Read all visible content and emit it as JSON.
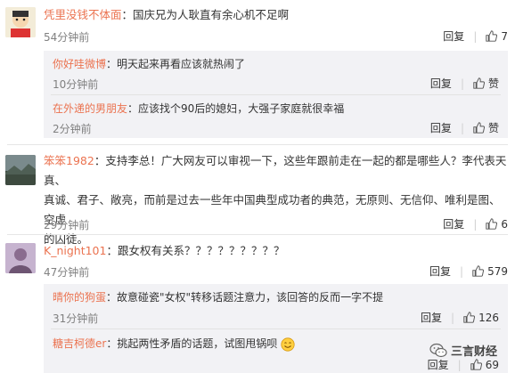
{
  "comments": [
    {
      "user": "凭里没钱不体面",
      "text": "国庆兄为人耿直有余心机不足啊",
      "time": "54分钟前",
      "reply_label": "回复",
      "likes": "7",
      "replies": [
        {
          "user": "你好哇微博",
          "text": "明天起来再看应该就热闹了",
          "time": "10分钟前",
          "reply_label": "回复",
          "likes": "赞"
        },
        {
          "user": "在外递的男朋友",
          "text": "应该找个90后的媳妇，大强子家庭就很幸福",
          "time": "2分钟前",
          "reply_label": "回复",
          "likes": "赞"
        }
      ]
    },
    {
      "user": "笨笨1982",
      "text_line1": "支持李总！广大网友可以审视一下，这些年跟前走在一起的都是哪些人？李代表天真、",
      "text_line2": "真诚、君子、敞亮，而前是过去一些年中国典型成功者的典范，无原则、无信仰、唯利是图、空虚",
      "text_line3": "的囚徒。",
      "time": "29分钟前",
      "reply_label": "回复",
      "likes": "6"
    },
    {
      "user": "K_night101",
      "text": "跟女权有关系？？？？？？？？？",
      "time": "47分钟前",
      "reply_label": "回复",
      "likes": "579",
      "replies": [
        {
          "user": "晴你的狗蛋",
          "text": "故意碰瓷\"女权\"转移话题注意力，该回答的反而一字不提",
          "time": "31分钟前",
          "reply_label": "回复",
          "likes": "126"
        },
        {
          "user": "糖吉柯德er",
          "text": "挑起两性矛盾的话题，试图甩锅呗",
          "time": "",
          "reply_label": "回复",
          "likes": "69"
        }
      ]
    }
  ],
  "watermark": "三言财经",
  "colors": {
    "username": "#eb7350",
    "time": "#808080",
    "reply_bg": "#f2f2f5"
  }
}
